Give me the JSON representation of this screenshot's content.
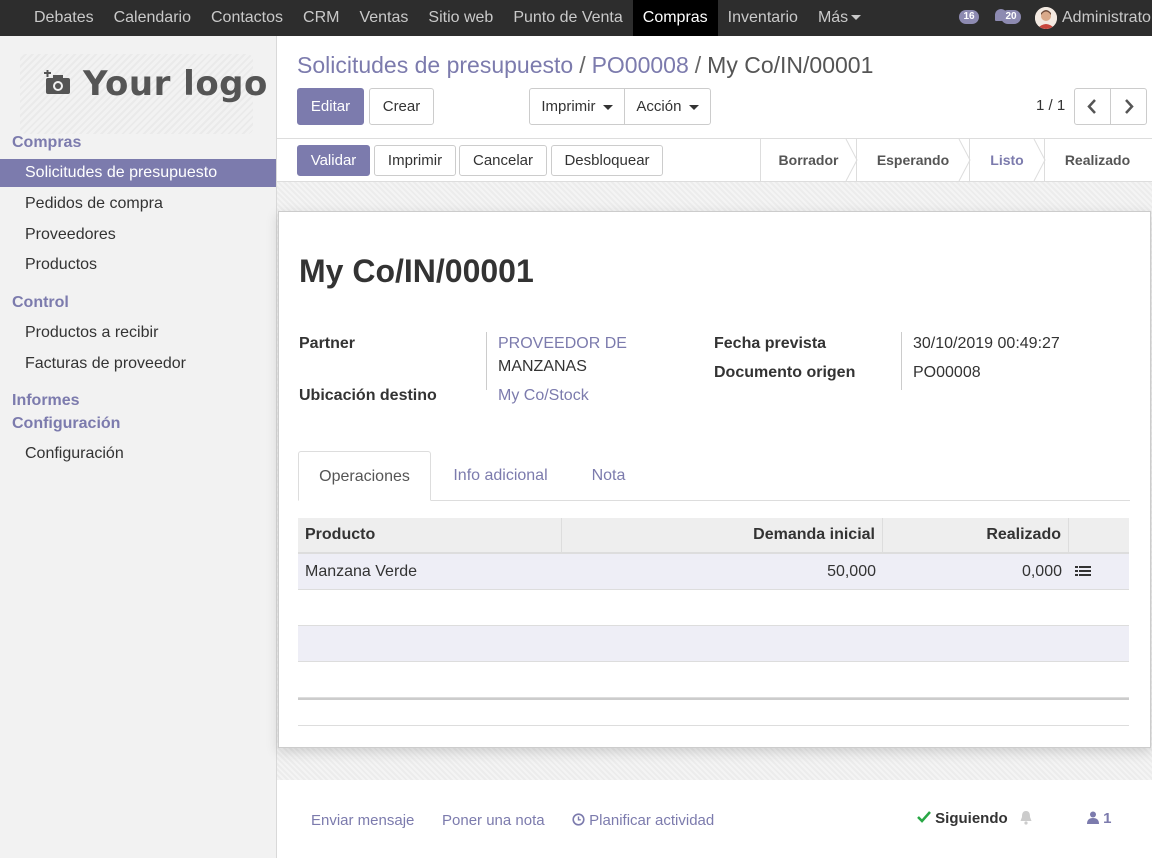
{
  "topbar": {
    "menu": [
      "Debates",
      "Calendario",
      "Contactos",
      "CRM",
      "Ventas",
      "Sitio web",
      "Punto de Venta",
      "Compras",
      "Inventario",
      "Más"
    ],
    "active": "Compras",
    "activities_count": "16",
    "messages_count": "20",
    "user": "Administrato"
  },
  "sidebar": {
    "logo": "Your logo",
    "sections": [
      {
        "title": "Compras",
        "items": [
          "Solicitudes de presupuesto",
          "Pedidos de compra",
          "Proveedores",
          "Productos"
        ]
      },
      {
        "title": "Control",
        "items": [
          "Productos a recibir",
          "Facturas de proveedor"
        ]
      },
      {
        "title": "Informes",
        "items": []
      },
      {
        "title": "Configuración",
        "items": [
          "Configuración"
        ]
      }
    ]
  },
  "breadcrumb": {
    "root": "Solicitudes de presupuesto",
    "parent": "PO00008",
    "current": "My Co/IN/00001"
  },
  "buttons": {
    "edit": "Editar",
    "create": "Crear",
    "print": "Imprimir",
    "action": "Acción"
  },
  "pager": "1 / 1",
  "status_buttons": {
    "validate": "Validar",
    "print": "Imprimir",
    "cancel": "Cancelar",
    "unlock": "Desbloquear"
  },
  "stages": [
    "Borrador",
    "Esperando",
    "Listo",
    "Realizado"
  ],
  "active_stage": "Listo",
  "record": {
    "title": "My Co/IN/00001",
    "partner_label": "Partner",
    "partner_line1": "PROVEEDOR DE",
    "partner_line2": "MANZANAS",
    "dest_label": "Ubicación destino",
    "dest_value": "My Co/Stock",
    "date_label": "Fecha prevista",
    "date_value": "30/10/2019 00:49:27",
    "origin_label": "Documento origen",
    "origin_value": "PO00008"
  },
  "tabs": [
    "Operaciones",
    "Info adicional",
    "Nota"
  ],
  "table": {
    "headers": [
      "Producto",
      "Demanda inicial",
      "Realizado"
    ],
    "rows": [
      {
        "product": "Manzana Verde",
        "demand": "50,000",
        "done": "0,000"
      }
    ]
  },
  "chatter": {
    "send": "Enviar mensaje",
    "note": "Poner una nota",
    "schedule": "Planificar actividad",
    "following": "Siguiendo",
    "followers": "1"
  },
  "colors": {
    "brand": "#7c7bad",
    "navbar": "#2d2d2d"
  },
  "icons": [
    "camera-icon",
    "chevron-left-icon",
    "chevron-right-icon",
    "list-icon",
    "clock-icon",
    "check-icon",
    "bell-icon",
    "user-icon",
    "chat-icon"
  ]
}
